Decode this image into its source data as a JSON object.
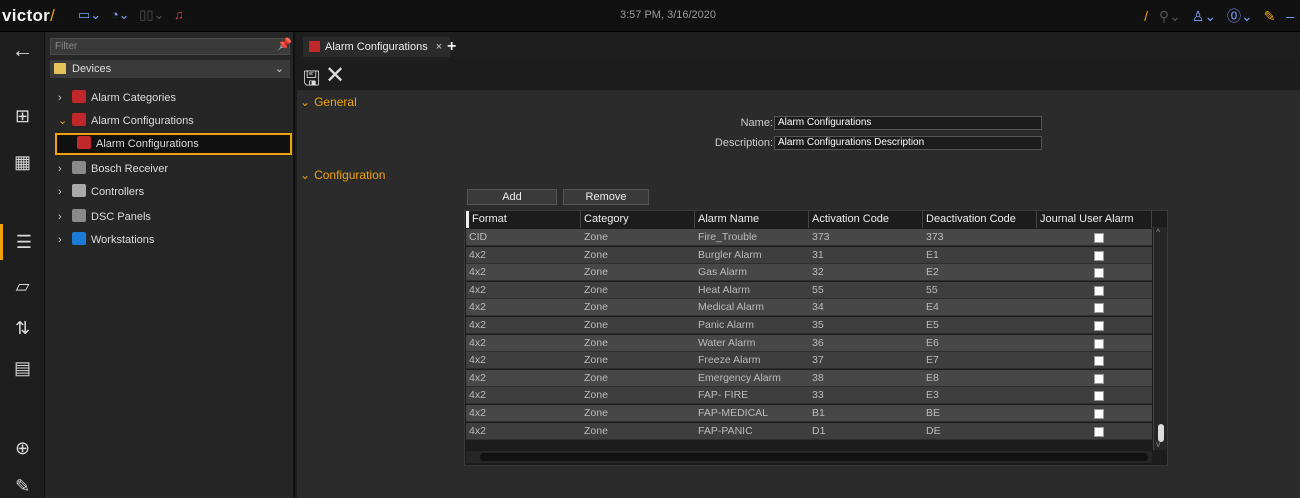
{
  "topbar": {
    "logo": "victor",
    "logo_slash": "/",
    "time": "3:57 PM, 3/16/2020"
  },
  "tree": {
    "filter_placeholder": "Filter",
    "devices_label": "Devices",
    "items": [
      {
        "label": "Alarm Categories",
        "icon": "alarm-category-icon"
      },
      {
        "label": "Alarm Configurations",
        "icon": "alarm-configuration-icon"
      },
      {
        "label": "Alarm Configurations",
        "icon": "alarm-configuration-icon"
      },
      {
        "label": "Bosch Receiver",
        "icon": "receiver-icon"
      },
      {
        "label": "Controllers",
        "icon": "controller-icon"
      },
      {
        "label": "DSC Panels",
        "icon": "panel-icon"
      },
      {
        "label": "Workstations",
        "icon": "workstation-icon"
      }
    ]
  },
  "tabs": [
    {
      "label": "Alarm Configurations",
      "close": "×"
    }
  ],
  "tab_add": "+",
  "general": {
    "heading": "General",
    "name_label": "Name:",
    "name_value": "Alarm Configurations",
    "description_label": "Description:",
    "description_value": "Alarm Configurations Description"
  },
  "configuration": {
    "heading": "Configuration",
    "add_label": "Add",
    "remove_label": "Remove",
    "columns": [
      "Format",
      "Category",
      "Alarm Name",
      "Activation Code",
      "Deactivation Code",
      "Journal User Alarm"
    ],
    "rows": [
      [
        "CID",
        "Zone",
        "Fire_Trouble",
        "373",
        "373",
        false
      ],
      [
        "4x2",
        "Zone",
        "Burgler Alarm",
        "31",
        "E1",
        false
      ],
      [
        "4x2",
        "Zone",
        " Gas Alarm",
        "32",
        "E2",
        false
      ],
      [
        "4x2",
        "Zone",
        "Heat Alarm",
        "55",
        "55",
        false
      ],
      [
        "4x2",
        "Zone",
        "Medical Alarm",
        "34",
        "E4",
        false
      ],
      [
        "4x2",
        "Zone",
        "Panic Alarm",
        "35",
        "E5",
        false
      ],
      [
        "4x2",
        "Zone",
        "Water Alarm",
        "36",
        "E6",
        false
      ],
      [
        "4x2",
        "Zone",
        "Freeze Alarm",
        "37",
        "E7",
        false
      ],
      [
        "4x2",
        "Zone",
        "Emergency Alarm",
        "38",
        "E8",
        false
      ],
      [
        "4x2",
        "Zone",
        "FAP- FIRE",
        "33",
        "E3",
        false
      ],
      [
        "4x2",
        "Zone",
        "FAP-MEDICAL",
        "B1",
        "BE",
        false
      ],
      [
        "4x2",
        "Zone",
        "FAP-PANIC",
        "D1",
        "DE",
        false
      ]
    ]
  },
  "colors": {
    "accent": "#f0a30a",
    "row_odd": "#474747",
    "row_even": "#3e3e3e"
  }
}
